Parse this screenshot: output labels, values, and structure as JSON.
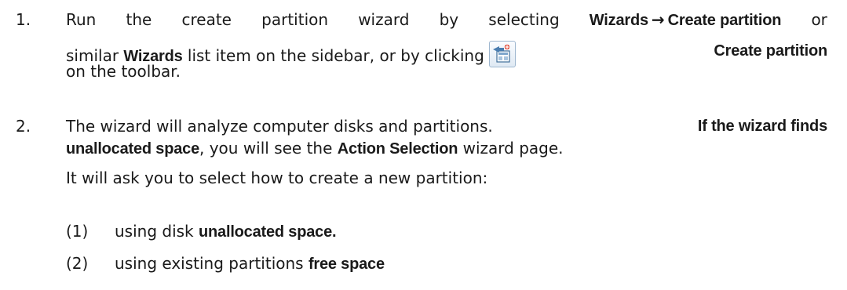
{
  "document": {
    "step1": {
      "number": "1.",
      "line1_a": "Run",
      "line1_b": "the",
      "line1_c": "create",
      "line1_d": "partition",
      "line1_e": "wizard",
      "line1_f": "by",
      "line1_g": "selecting",
      "wizards_menu": "Wizards",
      "arrow": "→",
      "create_partition_menu": "Create partition",
      "line1_end": "or",
      "line2_a": "similar",
      "wizards_list": "Wizards",
      "line2_b": "list item on the sidebar, or by clicking",
      "toolbar_icon": "create-partition-icon",
      "create_partition_button": "Create partition",
      "line3": "on the toolbar."
    },
    "step2": {
      "number": "2.",
      "line1_a": "The wizard will analyze computer disks and partitions.",
      "line1_bold": "If the wizard finds",
      "line2_bold": "unallocated space",
      "line2_a": ", you will see the",
      "action_selection": "Action Selection",
      "line2_b": "wizard page.",
      "line3": "It will ask you to select how to create a new partition:"
    },
    "options": [
      {
        "num": "(1)",
        "text": "using disk",
        "bold": "unallocated space."
      },
      {
        "num": "(2)",
        "text": "using existing partitions",
        "bold": "free space"
      }
    ]
  }
}
